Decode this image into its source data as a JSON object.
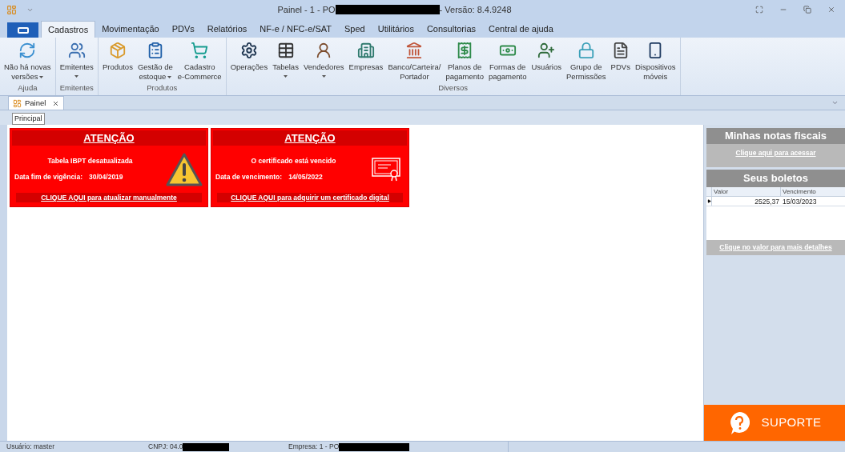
{
  "window": {
    "title_start": "Painel - 1 - PO",
    "title_end": "- Versão: 8.4.9248"
  },
  "menu_tabs": [
    {
      "label": "Cadastros",
      "selected": true
    },
    {
      "label": "Movimentação",
      "selected": false
    },
    {
      "label": "PDVs",
      "selected": false
    },
    {
      "label": "Relatórios",
      "selected": false
    },
    {
      "label": "NF-e / NFC-e/SAT",
      "selected": false
    },
    {
      "label": "Sped",
      "selected": false
    },
    {
      "label": "Utilitários",
      "selected": false
    },
    {
      "label": "Consultorias",
      "selected": false
    },
    {
      "label": "Central de ajuda",
      "selected": false
    }
  ],
  "ribbon_groups": [
    {
      "name": "Ajuda",
      "items": [
        {
          "label": [
            "Não há novas",
            "versões"
          ],
          "dropdown": true,
          "kind": "refresh"
        }
      ]
    },
    {
      "name": "Emitentes",
      "items": [
        {
          "label": [
            "Emitentes"
          ],
          "dropdown": true,
          "kind": "people"
        }
      ]
    },
    {
      "name": "Produtos",
      "items": [
        {
          "label": [
            "Produtos"
          ],
          "dropdown": false,
          "kind": "box"
        },
        {
          "label": [
            "Gestão de",
            "estoque"
          ],
          "dropdown": true,
          "kind": "clipboard"
        },
        {
          "label": [
            "Cadastro",
            "e-Commerce"
          ],
          "dropdown": false,
          "kind": "cart"
        }
      ]
    },
    {
      "name": "Diversos",
      "items": [
        {
          "label": [
            "Operações"
          ],
          "dropdown": false,
          "kind": "gears"
        },
        {
          "label": [
            "Tabelas"
          ],
          "dropdown": true,
          "kind": "table"
        },
        {
          "label": [
            "Vendedores"
          ],
          "dropdown": true,
          "kind": "person"
        },
        {
          "label": [
            "Empresas"
          ],
          "dropdown": false,
          "kind": "building"
        },
        {
          "label": [
            "Banco/Carteira/",
            "Portador"
          ],
          "dropdown": false,
          "kind": "bank"
        },
        {
          "label": [
            "Planos de",
            "pagamento"
          ],
          "dropdown": false,
          "kind": "receipt"
        },
        {
          "label": [
            "Formas de",
            "pagamento"
          ],
          "dropdown": false,
          "kind": "money"
        },
        {
          "label": [
            "Usuários"
          ],
          "dropdown": false,
          "kind": "users"
        },
        {
          "label": [
            "Grupo de",
            "Permissões"
          ],
          "dropdown": false,
          "kind": "lock"
        },
        {
          "label": [
            "PDVs"
          ],
          "dropdown": false,
          "kind": "ecf"
        },
        {
          "label": [
            "Dispositivos",
            "móveis"
          ],
          "dropdown": false,
          "kind": "phone"
        }
      ]
    }
  ],
  "document_tab": {
    "label": "Painel"
  },
  "sub_tab": {
    "label": "Principal"
  },
  "alerts": [
    {
      "kind": "warning",
      "title": "ATENÇÃO",
      "message": "Tabela IBPT desatualizada",
      "date_label": "Data fim de vigência:",
      "date": "30/04/2019",
      "link": "CLIQUE AQUI para atualizar manualmente"
    },
    {
      "kind": "certificate",
      "title": "ATENÇÃO",
      "message": "O certificado está vencido",
      "date_label": "Data de vencimento:",
      "date": "14/05/2022",
      "link": "CLIQUE AQUI para adquirir um certificado digital"
    }
  ],
  "notas": {
    "title": "Minhas notas fiscais",
    "link": "Clique aqui para acessar"
  },
  "boletos": {
    "title": "Seus boletos",
    "columns": [
      "Valor",
      "Vencimento"
    ],
    "rows": [
      {
        "valor": "2525,37",
        "vencimento": "15/03/2023",
        "selected": true
      }
    ],
    "link": "Clique no valor para mais detalhes"
  },
  "support_button": {
    "label": "SUPORTE"
  },
  "status_bar": {
    "user": "Usuário: master",
    "cnpj": "CNPJ: 04.0",
    "company": "Empresa: 1 - PO"
  }
}
